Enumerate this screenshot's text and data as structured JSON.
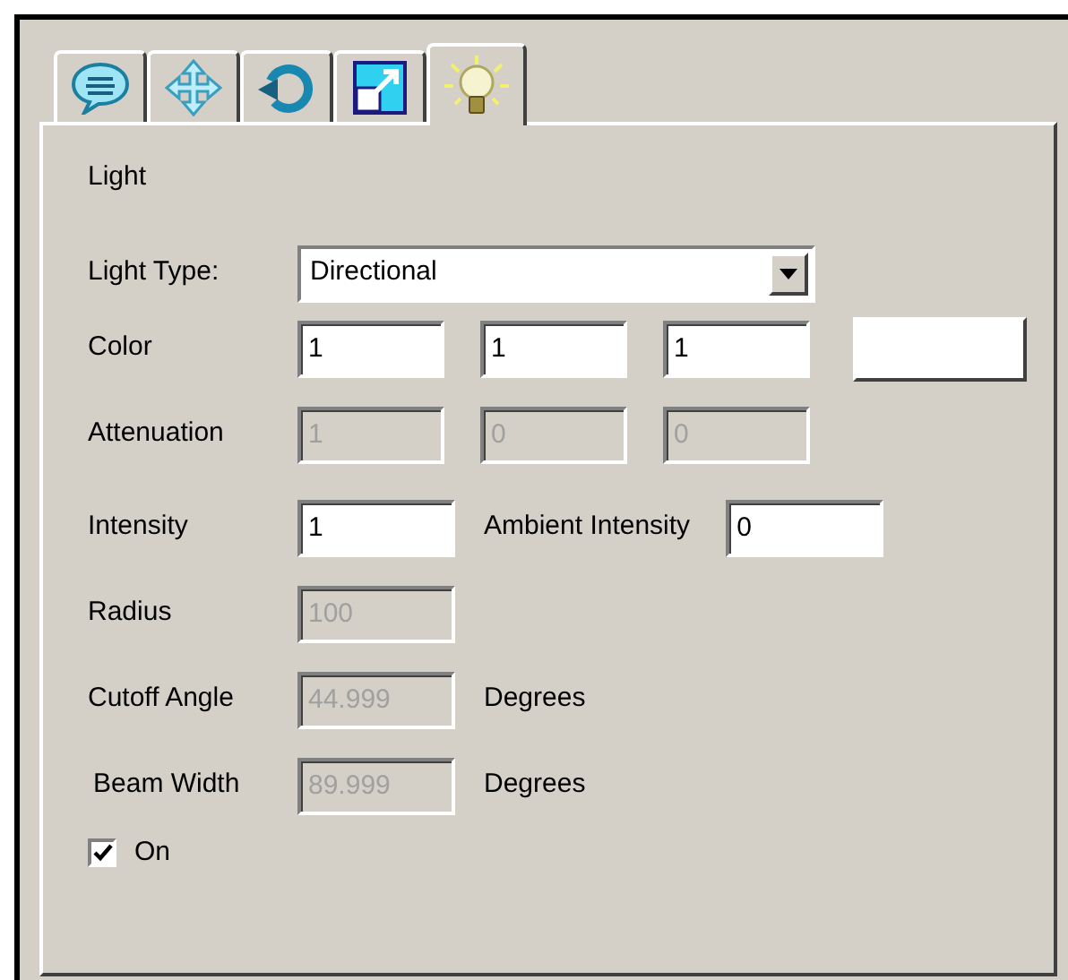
{
  "tabs": [
    {
      "kind": "speech",
      "selected": false
    },
    {
      "kind": "move",
      "selected": false
    },
    {
      "kind": "rotate",
      "selected": false
    },
    {
      "kind": "scale",
      "selected": false
    },
    {
      "kind": "light",
      "selected": true
    }
  ],
  "panel": {
    "title": "Light",
    "light_type": {
      "label": "Light Type:",
      "value": "Directional"
    },
    "color": {
      "label": "Color",
      "values": [
        "1",
        "1",
        "1"
      ],
      "color": "#ffffff"
    },
    "attenuation": {
      "label": "Attenuation",
      "values": [
        "1",
        "0",
        "0"
      ],
      "disabled": true
    },
    "intensity": {
      "label": "Intensity",
      "value": "1",
      "disabled": false
    },
    "ambient_intensity": {
      "label": "Ambient Intensity",
      "value": "0",
      "disabled": false
    },
    "radius": {
      "label": "Radius",
      "value": "100",
      "disabled": true
    },
    "cutoff_angle": {
      "label": "Cutoff Angle",
      "value": "44.999",
      "unit": "Degrees",
      "disabled": true
    },
    "beam_width": {
      "label": "Beam Width",
      "value": "89.999",
      "unit": "Degrees",
      "disabled": true
    },
    "on": {
      "label": "On",
      "checked": true
    }
  }
}
